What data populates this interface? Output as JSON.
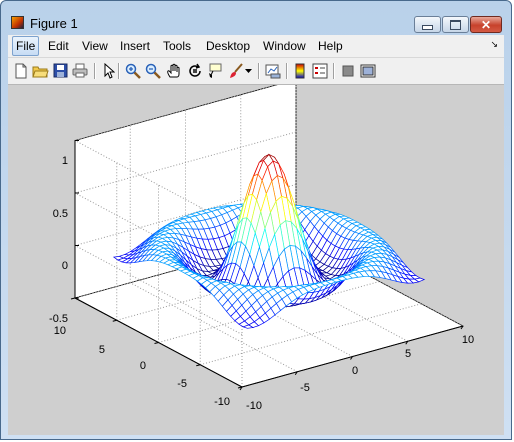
{
  "window": {
    "title": "Figure 1"
  },
  "menu": [
    "File",
    "Edit",
    "View",
    "Insert",
    "Tools",
    "Desktop",
    "Window",
    "Help"
  ],
  "toolbar_icons": [
    "new-figure-icon",
    "open-file-icon",
    "save-figure-icon",
    "print-figure-icon",
    "edit-plot-icon",
    "zoom-in-icon",
    "zoom-out-icon",
    "pan-icon",
    "rotate-3d-icon",
    "data-cursor-icon",
    "brush-icon",
    "brush-dropdown-icon",
    "link-plot-icon",
    "insert-colorbar-icon",
    "insert-legend-icon",
    "hide-plot-tools-icon",
    "show-plot-tools-icon"
  ],
  "plot": {
    "z_ticks": [
      "1",
      "0.5",
      "0",
      "-0.5"
    ],
    "y_ticks": [
      "10",
      "5",
      "0",
      "-5",
      "-10"
    ],
    "x_ticks": [
      "-10",
      "-5",
      "0",
      "5",
      "10"
    ]
  },
  "chart_data": {
    "type": "surface",
    "function": "sin(r)/r, r = sqrt(x^2 + y^2)",
    "x_range": [
      -8,
      8
    ],
    "y_range": [
      -8,
      8
    ],
    "zlim": [
      -0.5,
      1
    ],
    "colormap": "jet",
    "grid": true
  }
}
